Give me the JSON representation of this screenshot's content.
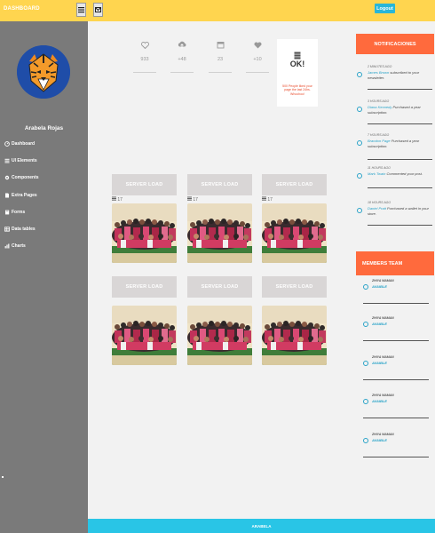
{
  "header": {
    "brand": "DASHBOARD",
    "logout_label": "Logout"
  },
  "sidebar": {
    "user_name": "Arabela Rojas",
    "items": [
      {
        "label": "Dashboard",
        "icon": "dashboard-icon"
      },
      {
        "label": "UI Elements",
        "icon": "list-icon"
      },
      {
        "label": "Components",
        "icon": "gear-icon"
      },
      {
        "label": "Extra Pages",
        "icon": "file-icon"
      },
      {
        "label": "Forms",
        "icon": "book-icon"
      },
      {
        "label": "Data tables",
        "icon": "table-icon"
      },
      {
        "label": "Charts",
        "icon": "chart-icon"
      }
    ]
  },
  "stats": [
    {
      "icon": "heart-icon",
      "value": "933"
    },
    {
      "icon": "upload-icon",
      "value": "+48"
    },
    {
      "icon": "calendar-icon",
      "value": "23"
    },
    {
      "icon": "heart-icon",
      "value": "+10"
    }
  ],
  "ok_card": {
    "title": "OK!",
    "text": "500 People liked your page the last 24hs. Whoohoo!"
  },
  "cards": [
    {
      "button": "SERVER LOAD",
      "count": "17"
    },
    {
      "button": "SERVER LOAD",
      "count": "17"
    },
    {
      "button": "SERVER LOAD",
      "count": "17"
    },
    {
      "button": "SERVER LOAD",
      "count": ""
    },
    {
      "button": "SERVER LOAD",
      "count": ""
    },
    {
      "button": "SERVER LOAD",
      "count": ""
    }
  ],
  "notifications": {
    "title": "NOTIFICACIONES",
    "items": [
      {
        "time": "2 MINUTES AGO",
        "name": "James Brown",
        "text": " subscribed to your newsletter."
      },
      {
        "time": "3 HOURS AGO",
        "name": "Diana Kennedy",
        "text": " Purchased a year subscription."
      },
      {
        "time": "7 HOURS AGO",
        "name": "Brandon Page",
        "text": " Purchased a year subscription."
      },
      {
        "time": "11 HOURS AGO",
        "name": "Mark Twain",
        "text": " Commented your post."
      },
      {
        "time": "18 HOURS AGO",
        "name": "Daniel Pratt",
        "text": " Purchased a wallet in your store."
      }
    ]
  },
  "members": {
    "title": "MEMBERS TEAM",
    "items": [
      {
        "name": "ZHIYA WAMAN",
        "status": "AVAIBLE"
      },
      {
        "name": "ZHIYA WAMAN",
        "status": "AVAIBLE"
      },
      {
        "name": "ZHIYA WAMAN",
        "status": "AVAIBLE"
      },
      {
        "name": "ZHIYA WAMAN",
        "status": "AVAIBLE"
      },
      {
        "name": "ZHIYA WAMAN",
        "status": "AVAIBLE"
      }
    ]
  },
  "footer": {
    "text": "ARABELA"
  },
  "colors": {
    "topbar": "#ffd54f",
    "sidebar": "#7a7a7a",
    "accent": "#29b6d8",
    "panel_header": "#ff6a3d"
  }
}
